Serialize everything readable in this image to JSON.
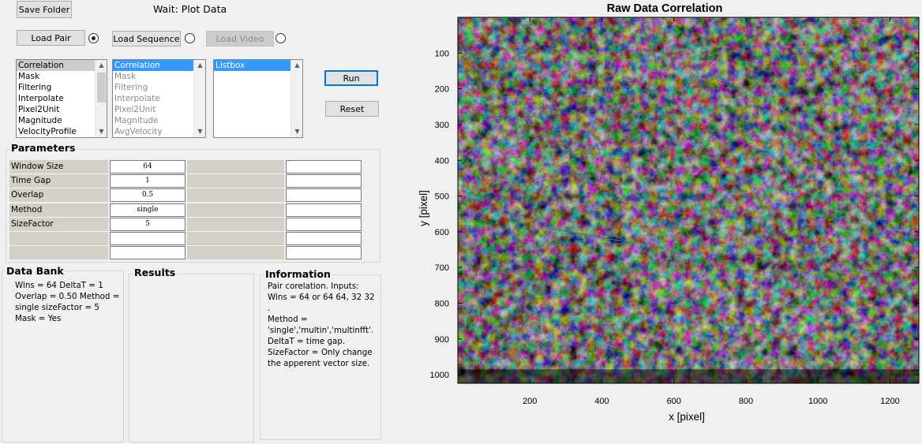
{
  "toolbar": {
    "save_folder_label": "Save Folder",
    "status_text": "Wait:  Plot Data"
  },
  "load": {
    "load_pair_label": "Load Pair",
    "load_sequence_label": "Load Sequence",
    "load_video_label": "Load Video",
    "selected": "pair"
  },
  "lists": {
    "analysis": [
      "Correlation",
      "Mask",
      "Filtering",
      "Interpolate",
      "Pixel2Unit",
      "Magnitude",
      "VelocityProfile"
    ],
    "analysis_selected": 0,
    "pipeline": [
      "Correlation",
      "Mask",
      "Filtering",
      "Interpolate",
      "Pixel2Unit",
      "Magnitude",
      "AvgVelocity"
    ],
    "pipeline_selected": 0,
    "listbox": [
      "Listbox"
    ],
    "listbox_selected": 0
  },
  "actions": {
    "run_label": "Run",
    "reset_label": "Reset"
  },
  "parameters": {
    "title": "Parameters",
    "rows": [
      {
        "label": "Window Size",
        "value": "64"
      },
      {
        "label": "Time Gap",
        "value": "1"
      },
      {
        "label": "Overlap",
        "value": "0.5"
      },
      {
        "label": "Method",
        "value": "single"
      },
      {
        "label": "SizeFactor",
        "value": "5"
      },
      {
        "label": "",
        "value": ""
      },
      {
        "label": "",
        "value": ""
      }
    ]
  },
  "data_bank": {
    "title": "Data Bank",
    "lines": [
      "Wins = 64  DeltaT = 1",
      "Overlap = 0.50  Method =",
      "single  sizeFactor = 5",
      "Mask = Yes"
    ]
  },
  "results": {
    "title": "Results"
  },
  "information": {
    "title": "Information",
    "lines": [
      "Pair corelation. Inputs:",
      "Wins = 64 or 64 64, 32 32 .",
      "Method =",
      "'single','multin','multinfft'.",
      "DeltaT = time gap.",
      "SizeFactor = Only change",
      "the apperent vector size."
    ]
  },
  "chart_data": {
    "type": "scatter",
    "title": "Raw Data Correlation",
    "xlabel": "x [pixel]",
    "ylabel": "y [pixel]",
    "xlim": [
      0,
      1280
    ],
    "ylim": [
      1024,
      0
    ],
    "x_ticks": [
      200,
      400,
      600,
      800,
      1000,
      1200
    ],
    "y_ticks": [
      100,
      200,
      300,
      400,
      500,
      600,
      700,
      800,
      900,
      1000
    ],
    "grid": false,
    "background": "grayscale particle image",
    "vector": {
      "x": 255,
      "y": 590,
      "u": 220,
      "v": 40,
      "color": "#1f77b4"
    }
  }
}
